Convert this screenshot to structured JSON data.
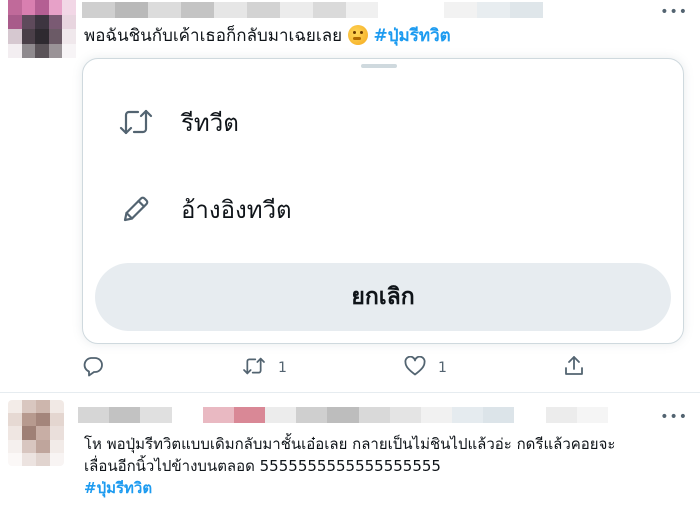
{
  "tweet1": {
    "text": "พอฉันชินกับเค้าเธอก็กลับมาเฉยเลย",
    "emoji": "thinking-face",
    "hashtag": "#ปุ่มรีทวิต",
    "more_label": "•••",
    "retweet_menu": {
      "retweet_label": "รีทวีต",
      "quote_label": "อ้างอิงทวีต",
      "cancel_label": "ยกเลิก"
    },
    "actions": {
      "reply_count": "",
      "retweet_count": "1",
      "like_count": "1"
    }
  },
  "tweet2": {
    "text_line1": "โห พอปุ่มรีทวิตแบบเดิมกลับมาชั้นเอ๋อเลย กลายเป็นไม่ชินไปแล้วอ่ะ กดรีแล้วคอยจะ",
    "text_line2": "เลื่อนอีกนิ้วไปข้างบนตลอด 5555555555555555555",
    "hashtag": "#ปุ่มรีทวิต",
    "more_label": "•••"
  },
  "colors": {
    "accent": "#1d9bf0",
    "muted": "#536471",
    "cancel_bg": "#e7ecf0"
  }
}
